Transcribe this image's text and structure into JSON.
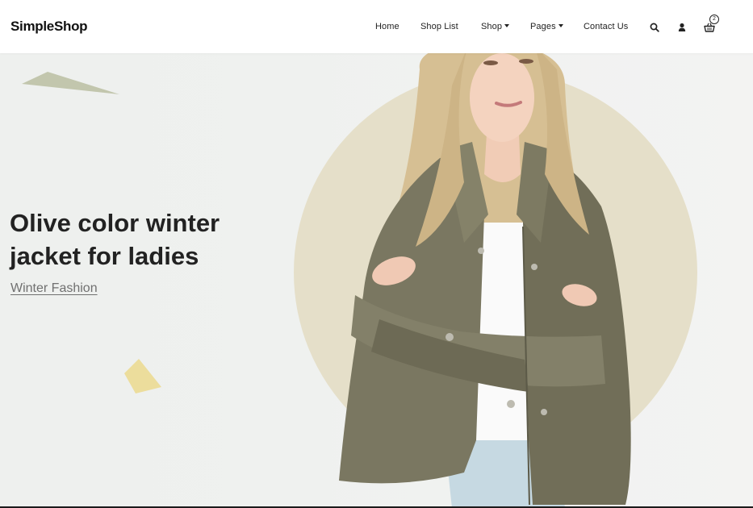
{
  "brand": {
    "name": "SimpleShop"
  },
  "nav": {
    "items": [
      {
        "label": "Home"
      },
      {
        "label": "Shop List"
      },
      {
        "label": "Shop"
      },
      {
        "label": "Pages"
      },
      {
        "label": "Contact Us"
      }
    ],
    "icons": {
      "search": "search-icon",
      "user": "user-icon",
      "cart": "basket-icon"
    },
    "cart_count": "2"
  },
  "hero": {
    "title": "Olive color winter jacket for ladies",
    "subtitle": "Winter Fashion",
    "colors": {
      "circle": "#e5dfc9",
      "triangle": "#c2c6ad",
      "diamond": "#ecdd9c",
      "jacket": "#7a7761"
    }
  }
}
